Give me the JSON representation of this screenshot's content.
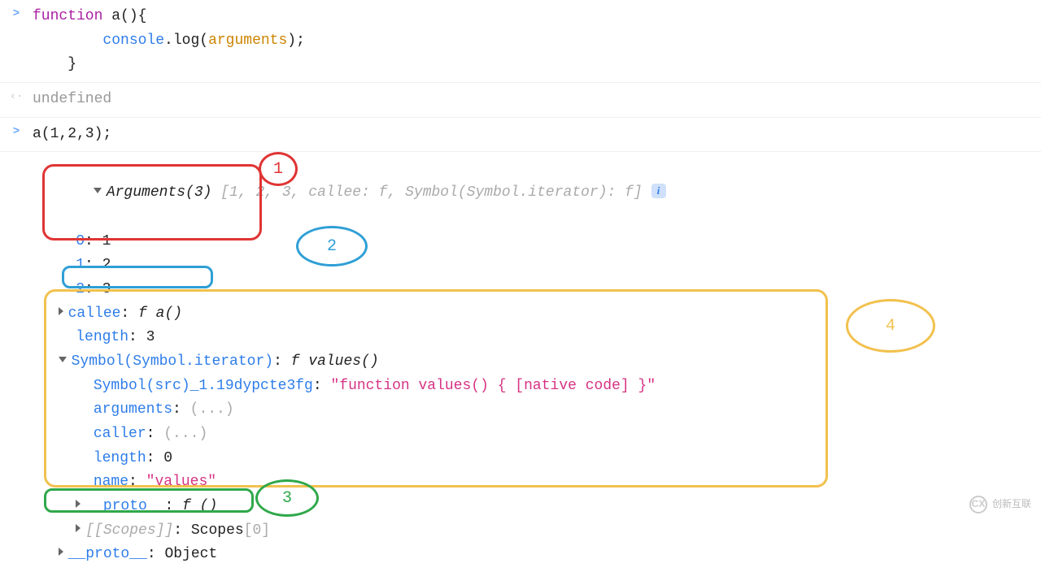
{
  "gutter": {
    "input": ">",
    "output": "‹·"
  },
  "code": {
    "def_kw": "function",
    "def_name": " a(){",
    "def_body_indent": "        ",
    "def_console": "console",
    "def_dot_log": ".log(",
    "def_args": "arguments",
    "def_close_call": ");",
    "def_close_fn": "    }",
    "return_undefined": "undefined",
    "call": "a(1,2,3);"
  },
  "arguments": {
    "header_prefix": "Arguments(3) ",
    "header_array": "[1, 2, 3, callee: f, Symbol(Symbol.iterator): f]",
    "items": [
      {
        "k": "0",
        "v": "1"
      },
      {
        "k": "1",
        "v": "2"
      },
      {
        "k": "2",
        "v": "3"
      }
    ],
    "callee_label": "callee",
    "callee_val_prefix": "f ",
    "callee_val_name": "a()",
    "length_label": "length",
    "length_val": "3",
    "symiter_label": "Symbol(Symbol.iterator)",
    "symiter_val_prefix": "f ",
    "symiter_val_name": "values()",
    "iter": {
      "src_label": "Symbol(src)_1.19dypcte3fg",
      "src_val": "\"function values() { [native code] }\"",
      "arguments_label": "arguments",
      "arguments_val": "(...)",
      "caller_label": "caller",
      "caller_val": "(...)",
      "length_label": "length",
      "length_val": "0",
      "name_label": "name",
      "name_val": "\"values\"",
      "proto_label": "__proto__",
      "proto_val_prefix": "f ",
      "proto_val_name": "()",
      "scopes_label": "[[Scopes]]",
      "scopes_val_prefix": "Scopes",
      "scopes_val_suffix": "[0]"
    },
    "proto_label": "__proto__",
    "proto_val": "Object"
  },
  "annotations": {
    "1": "1",
    "2": "2",
    "3": "3",
    "4": "4"
  },
  "watermark": {
    "text": "创新互联",
    "logo": "CX"
  }
}
